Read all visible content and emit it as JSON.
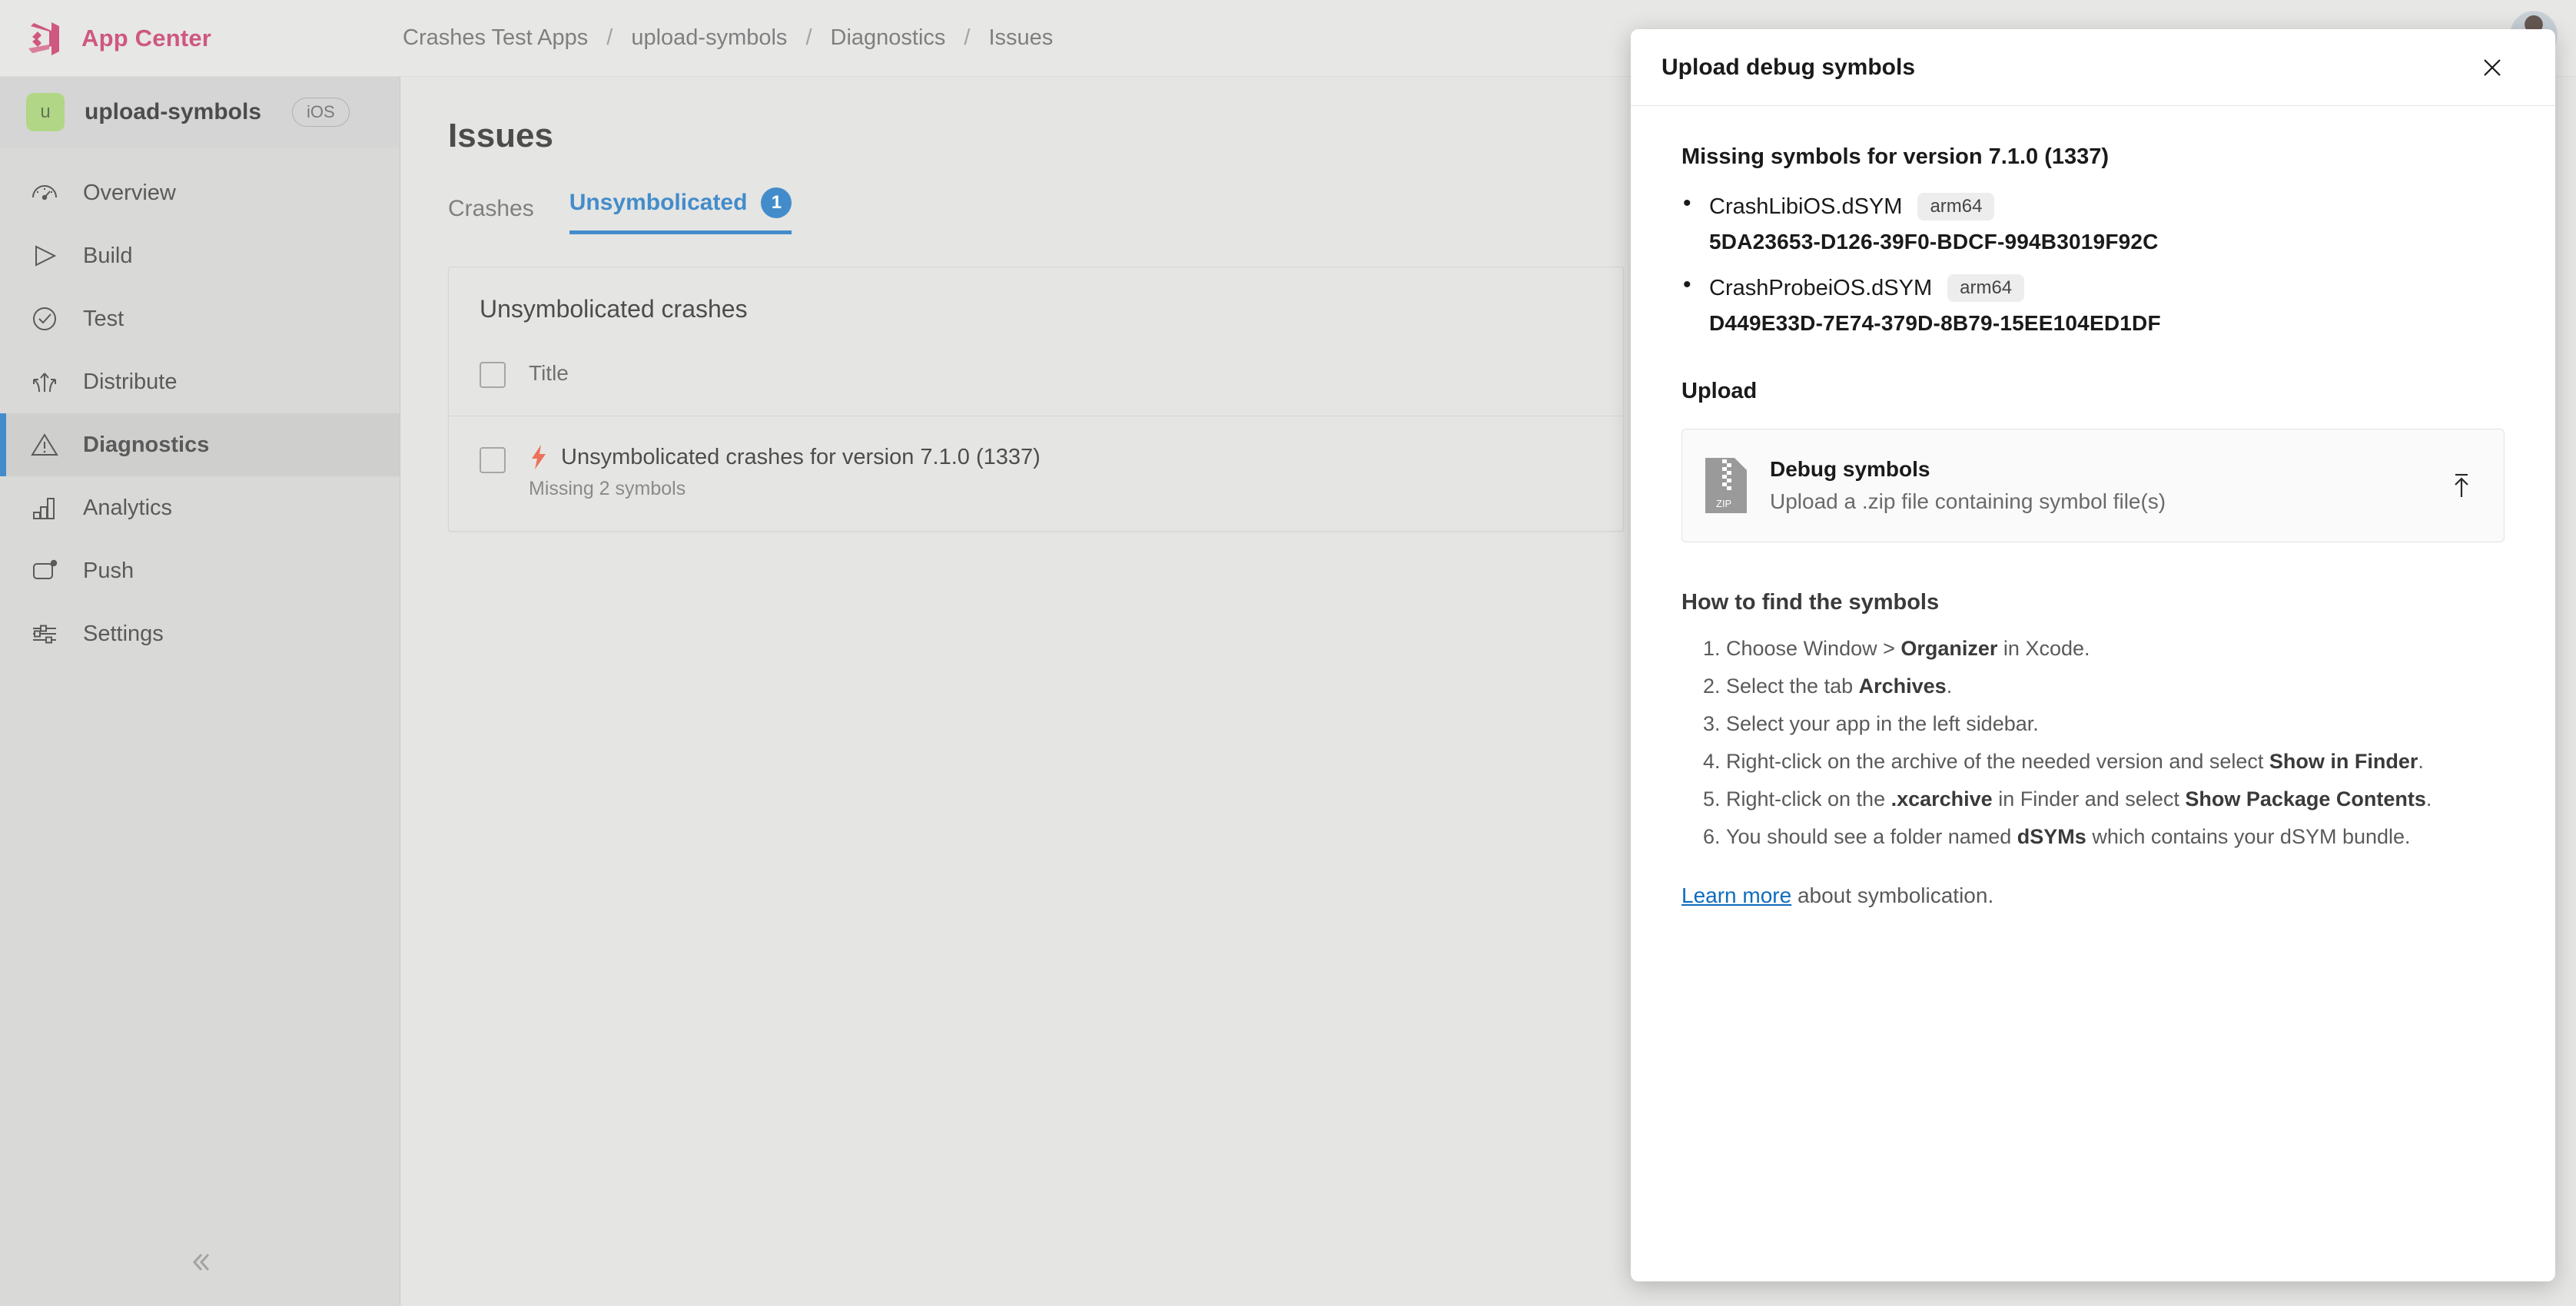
{
  "topbar": {
    "brand_name": "App Center",
    "logo_icon": "app-center-logo-icon",
    "avatar_icon": "user-avatar"
  },
  "breadcrumb": {
    "separator": "/",
    "items": [
      {
        "label": "Crashes Test Apps"
      },
      {
        "label": "upload-symbols"
      },
      {
        "label": "Diagnostics"
      },
      {
        "label": "Issues"
      }
    ]
  },
  "sidebar": {
    "app_initial": "u",
    "app_name": "upload-symbols",
    "os_badge": "iOS",
    "collapse_icon": "chevron-double-left-icon",
    "items": [
      {
        "label": "Overview",
        "icon": "gauge-icon",
        "active": false
      },
      {
        "label": "Build",
        "icon": "play-triangle-icon",
        "active": false
      },
      {
        "label": "Test",
        "icon": "check-circle-icon",
        "active": false
      },
      {
        "label": "Distribute",
        "icon": "distribute-arrows-icon",
        "active": false
      },
      {
        "label": "Diagnostics",
        "icon": "warning-triangle-icon",
        "active": true
      },
      {
        "label": "Analytics",
        "icon": "bar-chart-icon",
        "active": false
      },
      {
        "label": "Push",
        "icon": "push-notification-icon",
        "active": false
      },
      {
        "label": "Settings",
        "icon": "sliders-icon",
        "active": false
      }
    ]
  },
  "main": {
    "page_title": "Issues",
    "tabs": [
      {
        "label": "Crashes",
        "badge": null,
        "active": false
      },
      {
        "label": "Unsymbolicated",
        "badge": "1",
        "active": true
      }
    ],
    "card": {
      "title": "Unsymbolicated crashes",
      "column_header": "Title",
      "rows": [
        {
          "icon": "lightning-bolt-icon",
          "title": "Unsymbolicated crashes for version 7.1.0 (1337)",
          "subtitle": "Missing 2 symbols"
        }
      ]
    }
  },
  "modal": {
    "title": "Upload debug symbols",
    "close_icon": "close-icon",
    "missing_title": "Missing symbols for version 7.1.0 (1337)",
    "symbols": [
      {
        "name": "CrashLibiOS.dSYM",
        "arch": "arm64",
        "uuid": "5DA23653-D126-39F0-BDCF-994B3019F92C"
      },
      {
        "name": "CrashProbeiOS.dSYM",
        "arch": "arm64",
        "uuid": "D449E33D-7E74-379D-8B79-15EE104ED1DF"
      }
    ],
    "upload_label": "Upload",
    "upload_box": {
      "icon": "zip-file-icon",
      "icon_label": "ZIP",
      "title": "Debug symbols",
      "subtitle": "Upload a .zip file containing symbol file(s)",
      "action_icon": "upload-arrow-icon"
    },
    "howto_title": "How to find the symbols",
    "howto_steps": [
      {
        "pre": "Choose Window > ",
        "bold": "Organizer",
        "post": " in Xcode."
      },
      {
        "pre": "Select the tab ",
        "bold": "Archives",
        "post": "."
      },
      {
        "pre": "Select your app in the left sidebar.",
        "bold": "",
        "post": ""
      },
      {
        "pre": "Right-click on the archive of the needed version and select ",
        "bold": "Show in Finder",
        "post": "."
      },
      {
        "pre": "Right-click on the ",
        "bold": ".xcarchive",
        "post": " in Finder and select ",
        "bold2": "Show Package Contents",
        "post2": "."
      },
      {
        "pre": "You should see a folder named ",
        "bold": "dSYMs",
        "post": " which contains your dSYM bundle."
      }
    ],
    "learn_link": "Learn more",
    "learn_rest": " about symbolication."
  },
  "colors": {
    "brand": "#c02a5c",
    "accent": "#0f6cbd",
    "bolt": "#e8492b",
    "app_avatar": "#9ccc65"
  }
}
